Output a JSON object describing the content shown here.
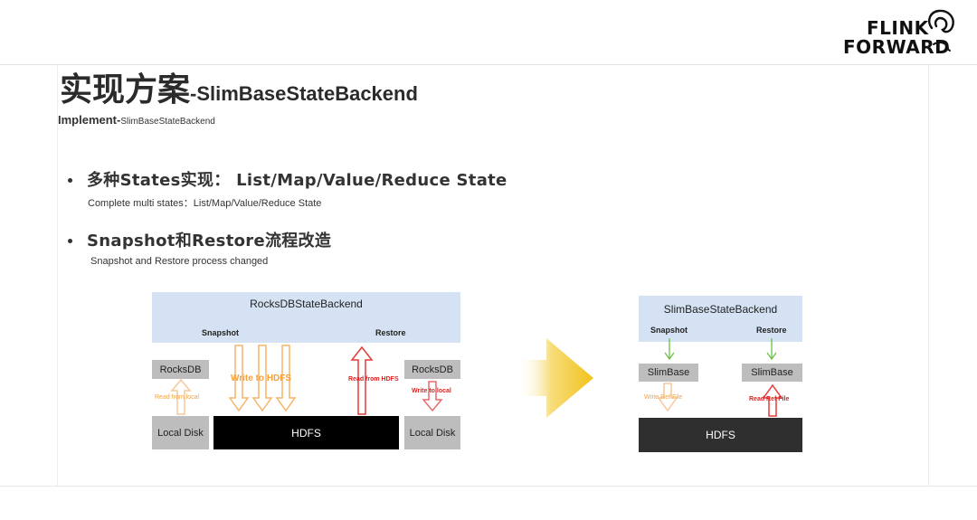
{
  "logo": {
    "line1": "FLINK",
    "line2": "FORWARD"
  },
  "title": {
    "zh": "实现方案",
    "en": "-SlimBaseStateBackend"
  },
  "subtitle": {
    "main": "Implement-",
    "small": "SlimBaseStateBackend"
  },
  "bullets": [
    {
      "main": "多种States实现： List/Map/Value/Reduce State",
      "sub": "Complete multi states：List/Map/Value/Reduce State"
    },
    {
      "main": "Snapshot和Restore流程改造",
      "sub": "Snapshot and Restore process changed"
    }
  ],
  "left_diagram": {
    "header": "RocksDBStateBackend",
    "snapshot": "Snapshot",
    "restore": "Restore",
    "rocksdb_left": "RocksDB",
    "rocksdb_right": "RocksDB",
    "local_disk_left": "Local Disk",
    "local_disk_right": "Local Disk",
    "hdfs": "HDFS",
    "write_to_hdfs": "Write to HDFS",
    "read_from_local": "Read from local",
    "read_from_hdfs": "Read from HDFS",
    "write_to_local": "Write to local"
  },
  "right_diagram": {
    "header": "SlimBaseStateBackend",
    "snapshot": "Snapshot",
    "restore": "Restore",
    "slimbase_left": "SlimBase",
    "slimbase_right": "SlimBase",
    "hdfs": "HDFS",
    "write_ref_file": "Write Ref File",
    "read_ref_file": "Read Ref File"
  },
  "colors": {
    "panel": "#d4e2f3",
    "orange": "#f6a23c",
    "red": "#e02020",
    "green": "#6cc04a",
    "arrow_gold": "#f2c21b"
  }
}
